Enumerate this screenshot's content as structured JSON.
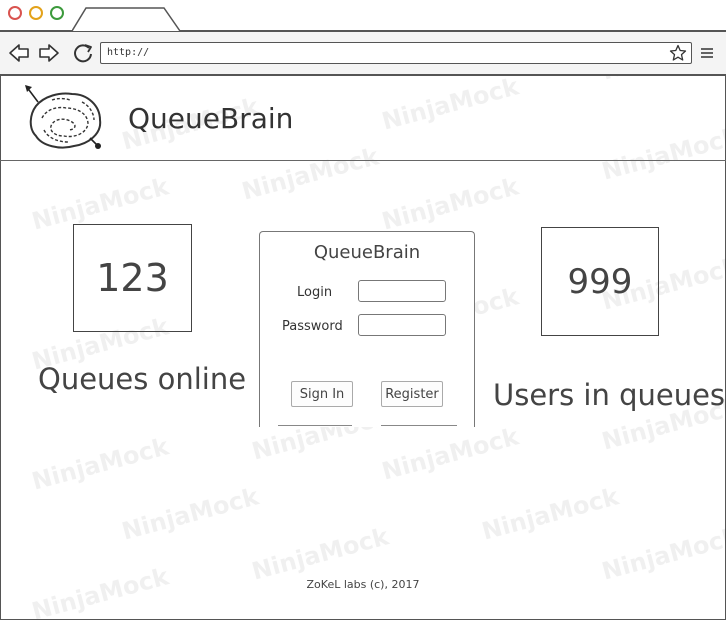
{
  "browser": {
    "url": "http://"
  },
  "header": {
    "brand": "QueueBrain"
  },
  "stats": {
    "queues_online": {
      "value": "123",
      "caption": "Queues online"
    },
    "users_in_queues": {
      "value": "999",
      "caption": "Users in queues"
    }
  },
  "login": {
    "title": "QueueBrain",
    "login_label": "Login",
    "login_value": "",
    "password_label": "Password",
    "password_value": "",
    "sign_in_label": "Sign In",
    "register_label": "Register"
  },
  "footer": {
    "text": "ZoKeL labs (c), 2017"
  },
  "watermark": {
    "text": "NinjaMock"
  },
  "colors": {
    "close": "#d9534f",
    "minimize": "#e3a21a",
    "maximize": "#3c9a3c"
  },
  "icons": [
    "back-arrow-icon",
    "forward-arrow-icon",
    "reload-icon",
    "star-icon",
    "menu-icon",
    "brain-maze-logo"
  ]
}
